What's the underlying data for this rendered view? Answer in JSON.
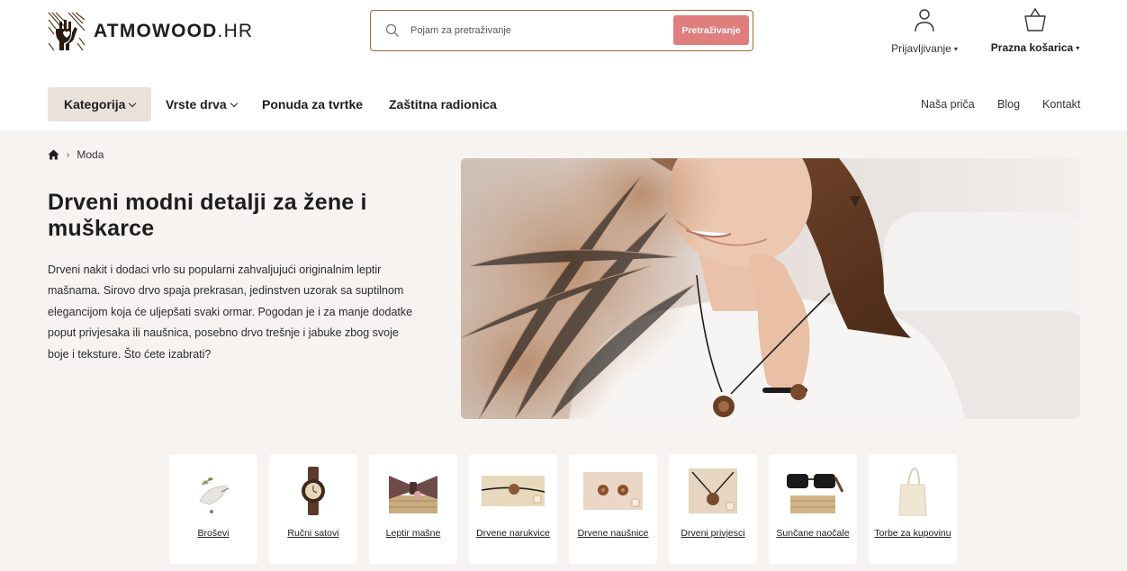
{
  "header": {
    "logo": {
      "brand": "ATMOWOOD",
      "suffix": ".HR"
    },
    "search": {
      "placeholder": "Pojam za pretraživanje",
      "button_label": "Pretraživanje"
    },
    "login_label": "Prijavljivanje",
    "cart_label": "Prazna košarica"
  },
  "nav": {
    "items": [
      {
        "label": "Kategorija"
      },
      {
        "label": "Vrste drva"
      },
      {
        "label": "Ponuda za tvrtke"
      },
      {
        "label": "Zaštitna radionica"
      }
    ],
    "right": [
      {
        "label": "Naša priča"
      },
      {
        "label": "Blog"
      },
      {
        "label": "Kontakt"
      }
    ]
  },
  "breadcrumb": {
    "current": "Moda"
  },
  "main": {
    "title": "Drveni modni detalji za žene i muškarce",
    "intro": "Drveni nakit i dodaci vrlo su popularni zahvaljujući originalnim leptir mašnama. Sirovo drvo spaja prekrasan, jedinstven uzorak sa suptilnom elegancijom koja će uljepšati svaki ormar. Pogodan je i za manje dodatke poput privjesaka ili naušnica, posebno drvo trešnje i jabuke zbog svoje boje i teksture. Što ćete izabrati?"
  },
  "categories": [
    {
      "label": "Broševi",
      "icon": "brooch-icon"
    },
    {
      "label": "Ručni satovi",
      "icon": "watch-icon"
    },
    {
      "label": "Leptir mašne",
      "icon": "bow-tie-icon"
    },
    {
      "label": "Drvene narukvice",
      "icon": "bracelet-icon"
    },
    {
      "label": "Drvene naušnice",
      "icon": "earrings-icon"
    },
    {
      "label": "Drveni privjesci",
      "icon": "pendant-icon"
    },
    {
      "label": "Sunčane naočale",
      "icon": "sunglasses-icon"
    },
    {
      "label": "Torbe za kupovinu",
      "icon": "tote-bag-icon"
    }
  ],
  "colors": {
    "accent": "#e07d7d",
    "search_border": "#9a6b3f",
    "band_bg": "#f6f3f0",
    "nav_active_bg": "#eae2da",
    "breadcrumb_sep": "#b06d44"
  }
}
